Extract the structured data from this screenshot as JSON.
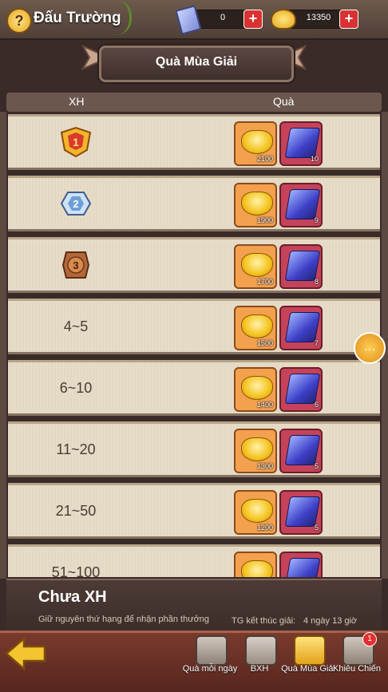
{
  "header": {
    "title": "Đấu Trường",
    "help_icon": "question-icon"
  },
  "resources": [
    {
      "icon": "ticket-icon",
      "value": "0"
    },
    {
      "icon": "gold-ingot-icon",
      "value": "13350"
    }
  ],
  "banner": {
    "title": "Quà Mùa Giải"
  },
  "columns": {
    "rank": "XH",
    "reward": "Quà"
  },
  "rows": [
    {
      "rank": "",
      "medal": "1",
      "gold": "2100",
      "scroll": "10"
    },
    {
      "rank": "",
      "medal": "2",
      "gold": "1900",
      "scroll": "9"
    },
    {
      "rank": "",
      "medal": "3",
      "gold": "1700",
      "scroll": "8"
    },
    {
      "rank": "4~5",
      "gold": "1500",
      "scroll": "7"
    },
    {
      "rank": "6~10",
      "gold": "1400",
      "scroll": "6"
    },
    {
      "rank": "11~20",
      "gold": "1300",
      "scroll": "5"
    },
    {
      "rank": "21~50",
      "gold": "1200",
      "scroll": "5"
    },
    {
      "rank": "51~100",
      "gold": "",
      "scroll": ""
    }
  ],
  "info": {
    "title": "Chưa XH",
    "desc": "Giữ nguyên thứ hạng để nhận phần thưởng",
    "end_label": "TG kết thúc giải:",
    "end_value": "4 ngày 13 giờ"
  },
  "nav": [
    {
      "label": "Quà mỗi ngày",
      "icon": "chest-icon"
    },
    {
      "label": "BXH",
      "icon": "cards-icon"
    },
    {
      "label": "Quà Mùa Giải",
      "icon": "season-gift-icon"
    },
    {
      "label": "Khiêu Chiến",
      "icon": "crossed-swords-icon",
      "badge": "1"
    }
  ]
}
